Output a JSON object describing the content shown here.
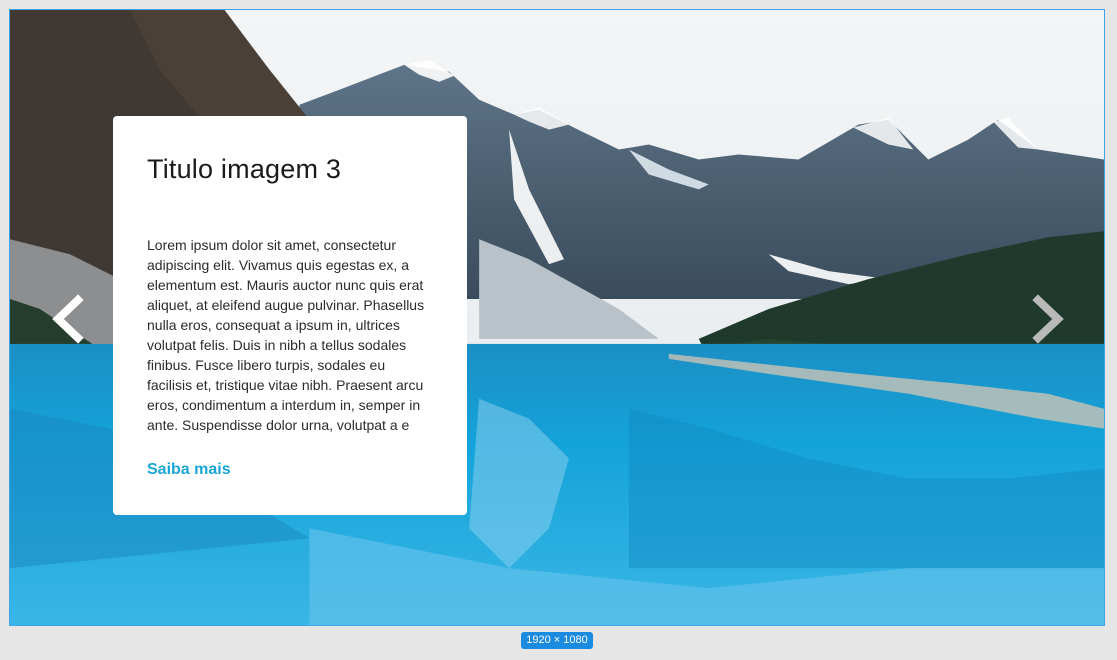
{
  "slide": {
    "title": "Titulo imagem 3",
    "body": "Lorem ipsum dolor sit amet, consectetur adipiscing elit. Vivamus quis egestas ex, a elementum est. Mauris auctor nunc quis erat aliquet, at eleifend augue pulvinar. Phasellus nulla eros, consequat a ipsum in, ultrices volutpat felis. Duis in nibh a tellus sodales finibus. Fusce libero turpis, sodales eu facilisis et, tristique vitae nibh. Praesent arcu eros, condimentum a interdum in, semper in ante. Suspendisse dolor urna, volutpat a e",
    "link_label": "Saiba mais",
    "image": "mountain-lake-photo"
  },
  "controls": {
    "prev_icon": "chevron-left-icon",
    "next_icon": "chevron-right-icon"
  },
  "frame": {
    "size_label": "1920 × 1080"
  },
  "colors": {
    "accent": "#19a5d6",
    "frame_border": "#3fa3e8",
    "badge": "#1b8be0"
  }
}
